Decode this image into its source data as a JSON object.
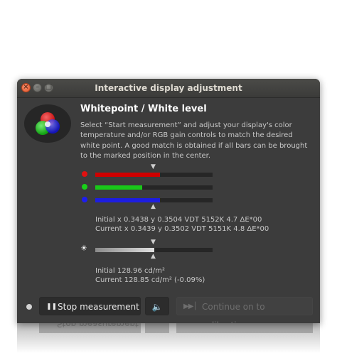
{
  "window": {
    "title": "Interactive display adjustment"
  },
  "content": {
    "heading": "Whitepoint / White level",
    "description": "Select “Start measurement” and adjust your display's color temperature and/or RGB gain controls to match the desired white point. A good match is obtained if all bars can be brought to the marked position in the center.",
    "rgb_bars": [
      {
        "channel": "red",
        "color": "#d00000",
        "level": 0.55
      },
      {
        "channel": "green",
        "color": "#19c819",
        "level": 0.4
      },
      {
        "channel": "blue",
        "color": "#1d1de0",
        "level": 0.55
      }
    ],
    "rgb_marker_glyph": "▲",
    "rgb_marker_top_glyph": "▼",
    "whitepoint_initial": "Initial x 0.3438 y 0.3504 VDT 5152K 4.7 ΔE*00",
    "whitepoint_current": "Current x 0.3439 y 0.3502 VDT 5151K 4.8 ΔE*00",
    "brightness_icon": "☀",
    "brightness_bar": {
      "level": 0.5,
      "color": "#e0e0e0"
    },
    "luminance_initial": "Initial 128.96 cd/m²",
    "luminance_current": "Current 128.85 cd/m² (-0.09%)"
  },
  "buttons": {
    "stop_icon": "❚❚",
    "stop_label": "Stop measurement",
    "sound_icon": "🔈",
    "continue_icon": "▶▶│",
    "continue_label": "Continue on to calibration"
  },
  "titlebar_buttons": {
    "close": "×",
    "minimize": "–",
    "maximize": "□"
  }
}
